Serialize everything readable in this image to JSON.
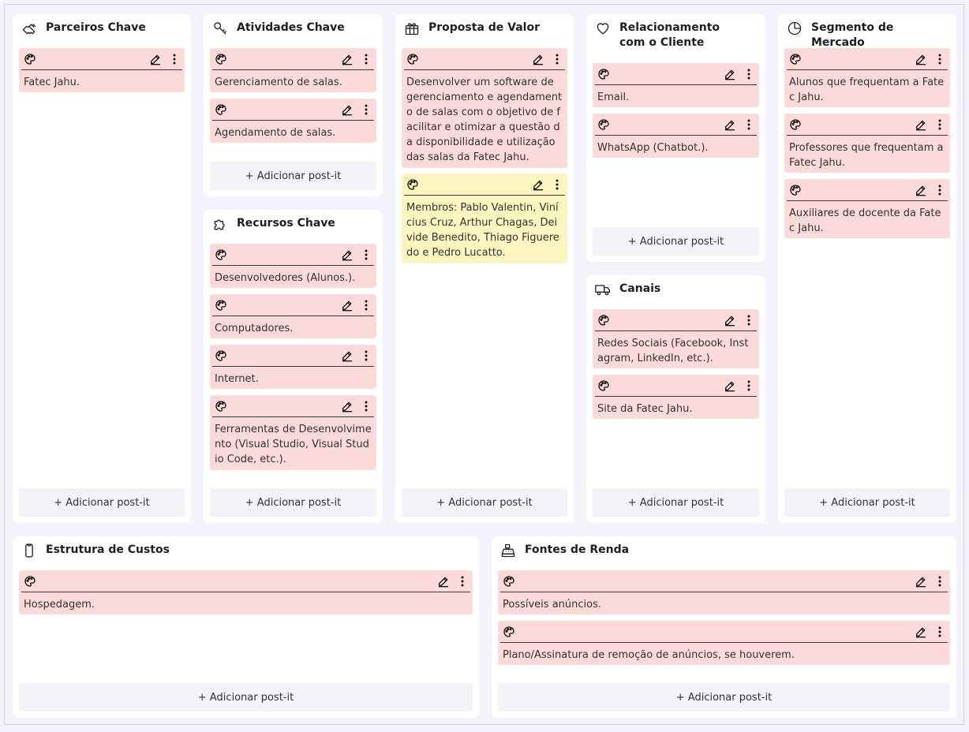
{
  "add_label": "+ Adicionar post-it",
  "colors": {
    "note_pink": "#fcdada",
    "note_yellow": "#fdf5c0",
    "block_bg": "#ffffff",
    "board_bg": "#f3f4fb"
  },
  "blocks": {
    "parceiros": {
      "title": "Parceiros Chave",
      "icon": "handshake-icon",
      "notes": [
        "Fatec Jahu."
      ]
    },
    "atividades": {
      "title": "Atividades Chave",
      "icon": "key-icon",
      "notes": [
        "Gerenciamento de salas.",
        "Agendamento de salas."
      ]
    },
    "recursos": {
      "title": "Recursos Chave",
      "icon": "puzzle-icon",
      "notes": [
        "Desenvolvedores (Alunos.).",
        "Computadores.",
        "Internet.",
        "Ferramentas de Desenvolvimento (Visual Studio, Visual Studio Code, etc.)."
      ]
    },
    "proposta": {
      "title": "Proposta de Valor",
      "icon": "gift-icon",
      "notes": [
        "Desenvolver um software de gerenciamento e agendamento de salas com o objetivo de facilitar e otimizar a questão da disponibilidade e utilização das salas da Fatec Jahu.",
        "Membros: Pablo Valentin, Vinícius Cruz, Arthur Chagas, Deivide Benedito, Thiago Figueredo e Pedro Lucatto."
      ]
    },
    "relacionamento": {
      "title": "Relacionamento com o Cliente",
      "icon": "heart-icon",
      "notes": [
        "Email.",
        "WhatsApp (Chatbot.)."
      ]
    },
    "canais": {
      "title": "Canais",
      "icon": "truck-icon",
      "notes": [
        "Redes Sociais (Facebook, Instagram, LinkedIn, etc.).",
        "Site da Fatec Jahu."
      ]
    },
    "segmento": {
      "title": "Segmento de Mercado",
      "icon": "pie-chart-icon",
      "notes": [
        "Alunos que frequentam a Fatec Jahu.",
        "Professores que frequentam a Fatec Jahu.",
        "Auxiliares de docente da Fatec Jahu."
      ]
    },
    "custos": {
      "title": "Estrutura de Custos",
      "icon": "phone-icon",
      "notes": [
        "Hospedagem."
      ]
    },
    "receitas": {
      "title": "Fontes de Renda",
      "icon": "cash-register-icon",
      "notes": [
        "Possíveis anúncios.",
        "Plano/Assinatura de remoção de anúncios, se houverem."
      ]
    }
  }
}
